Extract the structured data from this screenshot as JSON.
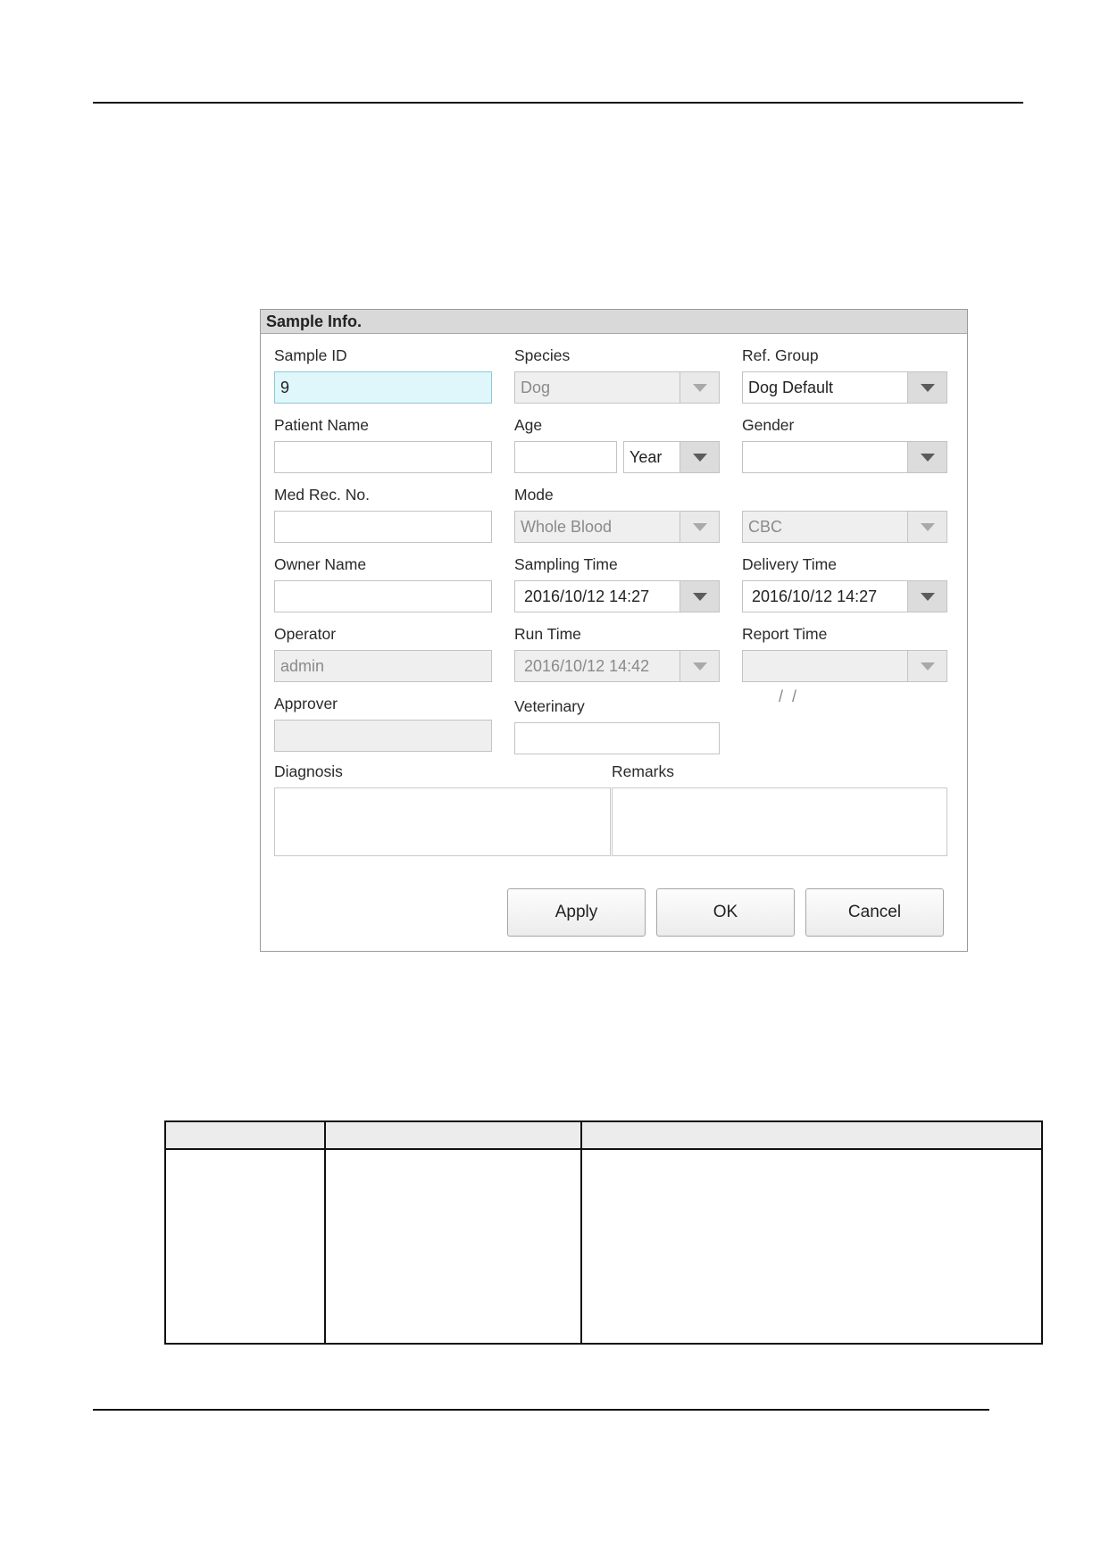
{
  "dialog": {
    "title": "Sample Info.",
    "labels": {
      "sample_id": "Sample ID",
      "species": "Species",
      "ref_group": "Ref. Group",
      "patient_name": "Patient Name",
      "age": "Age",
      "gender": "Gender",
      "med_rec_no": "Med Rec. No.",
      "mode": "Mode",
      "owner_name": "Owner Name",
      "sampling_time": "Sampling Time",
      "delivery_time": "Delivery Time",
      "operator": "Operator",
      "run_time": "Run Time",
      "report_time": "Report Time",
      "approver": "Approver",
      "veterinary": "Veterinary",
      "diagnosis": "Diagnosis",
      "remarks": "Remarks"
    },
    "values": {
      "sample_id": "9",
      "species": "Dog",
      "ref_group": "Dog Default",
      "patient_name": "",
      "age": "",
      "age_unit": "Year",
      "gender": "",
      "med_rec_no": "",
      "mode": "Whole Blood",
      "test_type": "CBC",
      "owner_name": "",
      "sampling_time": "2016/10/12 14:27",
      "delivery_time": "2016/10/12 14:27",
      "operator": "admin",
      "run_time": "2016/10/12 14:42",
      "report_time": "  /  /",
      "approver": "",
      "veterinary": ""
    },
    "buttons": {
      "apply": "Apply",
      "ok": "OK",
      "cancel": "Cancel"
    }
  },
  "colors": {
    "focused_field": "#dff6fb",
    "disabled_field": "#efefef",
    "title_bar": "#d9d9d9"
  }
}
